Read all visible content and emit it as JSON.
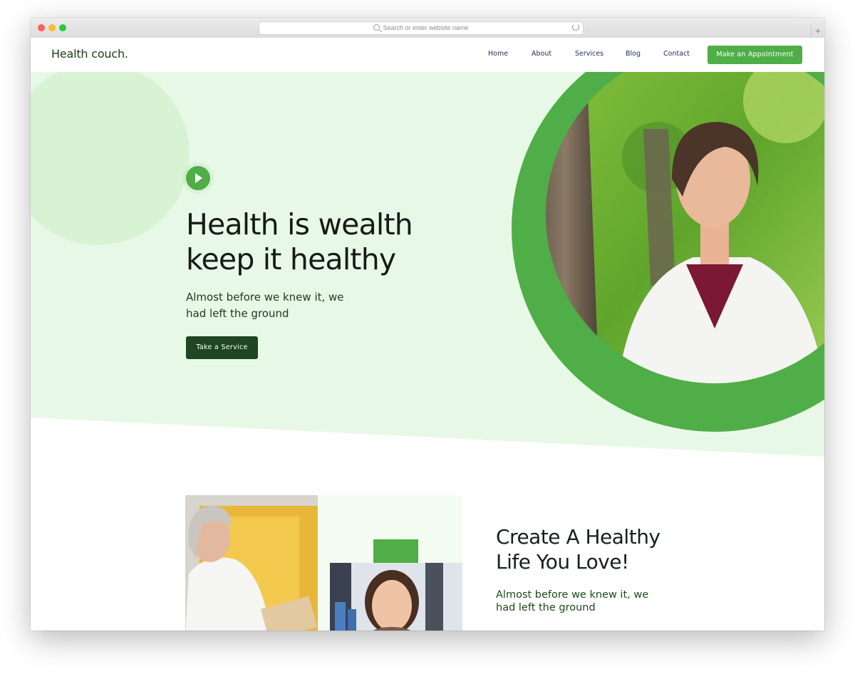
{
  "browser": {
    "address_placeholder": "Search or enter website name",
    "new_tab_label": "+"
  },
  "header": {
    "logo": "Health couch.",
    "nav": [
      "Home",
      "About",
      "Services",
      "Blog",
      "Contact"
    ],
    "cta": "Make an Appointment"
  },
  "hero": {
    "title_lines": [
      "Health is wealth",
      "keep it healthy"
    ],
    "subtitle_lines": [
      "Almost before we knew it, we",
      "had left the ground"
    ],
    "button": "Take a Service"
  },
  "section": {
    "title_lines": [
      "Create A Healthy",
      "Life You Love!"
    ],
    "subtitle_lines": [
      "Almost before we knew it, we",
      "had left the ground"
    ]
  },
  "colors": {
    "brand_green": "#4fae47",
    "dark_green": "#1e4620",
    "hero_background": "#e8f8e6",
    "decor_circle": "#d8f3d4"
  },
  "icons": [
    "play-icon",
    "search-icon",
    "reload-icon"
  ]
}
